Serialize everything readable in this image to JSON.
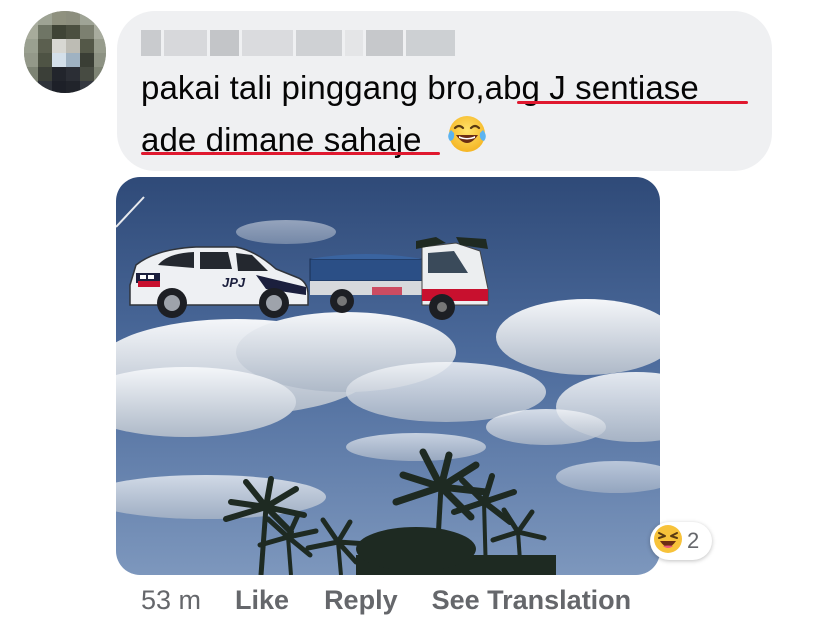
{
  "comment": {
    "author_blurred": true,
    "line1_plain": "pakai tali pinggang bro,",
    "line1_underlined": "abg J sentiase",
    "line2_underlined": "ade dimane sahaje",
    "emoji": "face-with-tears-of-joy",
    "underline_color": "#e0182f"
  },
  "photo": {
    "vehicle_label": "JPJ",
    "reaction_emoji": "laughing-squinting-face",
    "reaction_count": "2"
  },
  "actions": {
    "time": "53 m",
    "like": "Like",
    "reply": "Reply",
    "translate": "See Translation"
  },
  "colors": {
    "bubble": "#eff0f2",
    "meta_text": "#65676b",
    "text": "#050505"
  }
}
